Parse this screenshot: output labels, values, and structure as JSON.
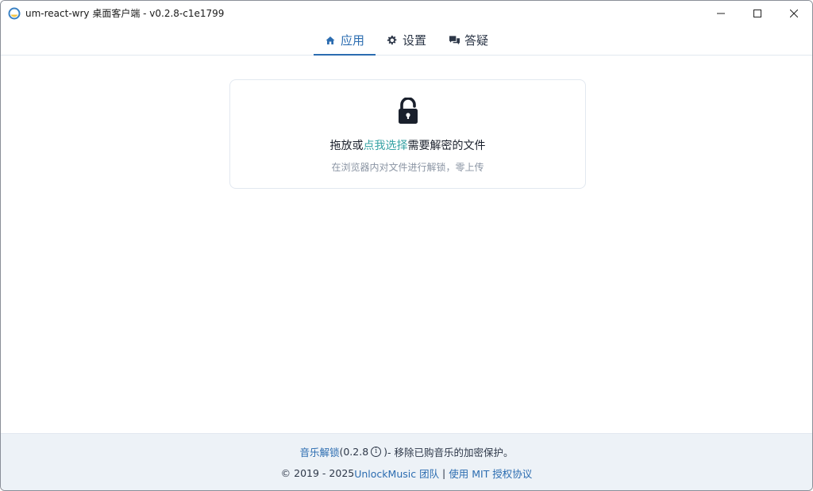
{
  "window": {
    "title": "um-react-wry 桌面客户端 - v0.2.8-c1e1799",
    "controls": [
      "minimize-icon",
      "maximize-icon",
      "close-icon"
    ]
  },
  "tabs": [
    {
      "label": "应用",
      "icon": "home-icon",
      "active": true
    },
    {
      "label": "设置",
      "icon": "gear-icon",
      "active": false
    },
    {
      "label": "答疑",
      "icon": "chat-icon",
      "active": false
    }
  ],
  "dropzone": {
    "icon": "unlock-icon",
    "title_prefix": "拖放或",
    "title_link": "点我选择",
    "title_suffix": "需要解密的文件",
    "subtitle": "在浏览器内对文件进行解锁，零上传"
  },
  "footer": {
    "app_link": "音乐解锁",
    "version": "(0.2.8",
    "version_close": ")",
    "tagline": " - 移除已购音乐的加密保护。",
    "copyright": "© 2019 - 2025 ",
    "team_link": "UnlockMusic 团队",
    "separator": " | ",
    "license_link": "使用 MIT 授权协议"
  },
  "colors": {
    "accent": "#2b6cb0",
    "link_teal": "#38a3a5",
    "footer_bg": "#edf2f7",
    "border": "#e2e8f0"
  }
}
